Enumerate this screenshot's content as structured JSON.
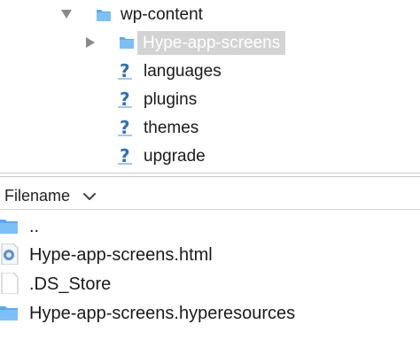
{
  "tree": {
    "root": {
      "label": "wp-content",
      "icon": "folder-icon",
      "expanded": true
    },
    "selected": {
      "label": "Hype-app-screens",
      "icon": "folder-icon",
      "expanded": false
    },
    "children": [
      {
        "label": "languages",
        "icon": "question-icon"
      },
      {
        "label": "plugins",
        "icon": "question-icon"
      },
      {
        "label": "themes",
        "icon": "question-icon"
      },
      {
        "label": "upgrade",
        "icon": "question-icon"
      }
    ]
  },
  "file_list": {
    "column_header": "Filename",
    "sort_icon": "chevron-down-icon",
    "rows": [
      {
        "name": "..",
        "icon": "folder-icon"
      },
      {
        "name": "Hype-app-screens.html",
        "icon": "html-file-icon"
      },
      {
        "name": ".DS_Store",
        "icon": "blank-file-icon"
      },
      {
        "name": "Hype-app-screens.hyperesources",
        "icon": "folder-icon"
      }
    ]
  },
  "colors": {
    "folder_blue": "#5aa9f0",
    "selection_bg": "#d3d3d3",
    "question_blue": "#2f6fb8"
  }
}
